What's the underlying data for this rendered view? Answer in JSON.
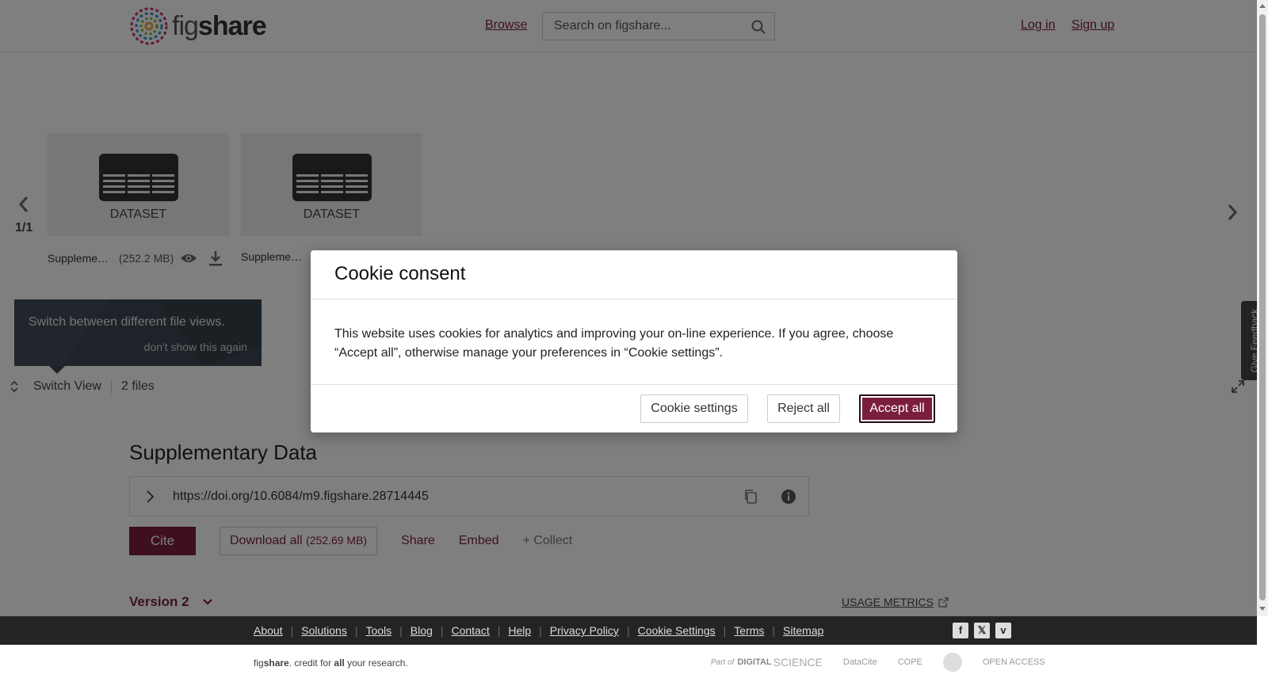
{
  "header": {
    "brand_prefix": "fig",
    "brand_suffix": "share",
    "browse": "Browse",
    "search_placeholder": "Search on figshare...",
    "login": "Log in",
    "signup": "Sign up"
  },
  "viewer": {
    "counter": "1/1",
    "tiles": [
      {
        "label": "DATASET",
        "name": "Suppleme…",
        "size": "(252.2 MB)"
      },
      {
        "label": "DATASET",
        "name": "Suppleme…",
        "size": "("
      }
    ],
    "tooltip": {
      "text": "Switch between different file views.",
      "dismiss": "don't show this again"
    },
    "switch_view": "Switch View",
    "file_count": "2 files"
  },
  "item": {
    "title": "Supplementary Data",
    "doi": "https://doi.org/10.6084/m9.figshare.28714445",
    "cite": "Cite",
    "download_all": "Download all",
    "download_size": "(252.69 MB)",
    "share": "Share",
    "embed": "Embed",
    "collect": "+ Collect",
    "version": "Version 2",
    "usage_metrics": "USAGE METRICS"
  },
  "feedback": "Give Feedback",
  "footer": {
    "links": [
      "About",
      "Solutions",
      "Tools",
      "Blog",
      "Contact",
      "Help",
      "Privacy Policy",
      "Cookie Settings",
      "Terms",
      "Sitemap"
    ],
    "tagline_a": "fig",
    "tagline_b": "share",
    "tagline_c": ". credit for ",
    "tagline_d": "all",
    "tagline_e": " your research.",
    "partner_prefix": "Part of",
    "partner_name": "DIGITAL",
    "partner_suffix": "SCIENCE",
    "datacite": "DataCite",
    "cope": "COPE",
    "open_access": "OPEN ACCESS"
  },
  "cookie": {
    "title": "Cookie consent",
    "text": "This website uses cookies for analytics and improving your on-line experience. If you agree, choose “Accept all”, otherwise manage your preferences in “Cookie settings”.",
    "settings": "Cookie settings",
    "reject": "Reject all",
    "accept": "Accept all"
  },
  "colors": {
    "brand": "#7b1e3e",
    "tooltip_bg": "#3c4652",
    "footer_bg": "#242424"
  }
}
